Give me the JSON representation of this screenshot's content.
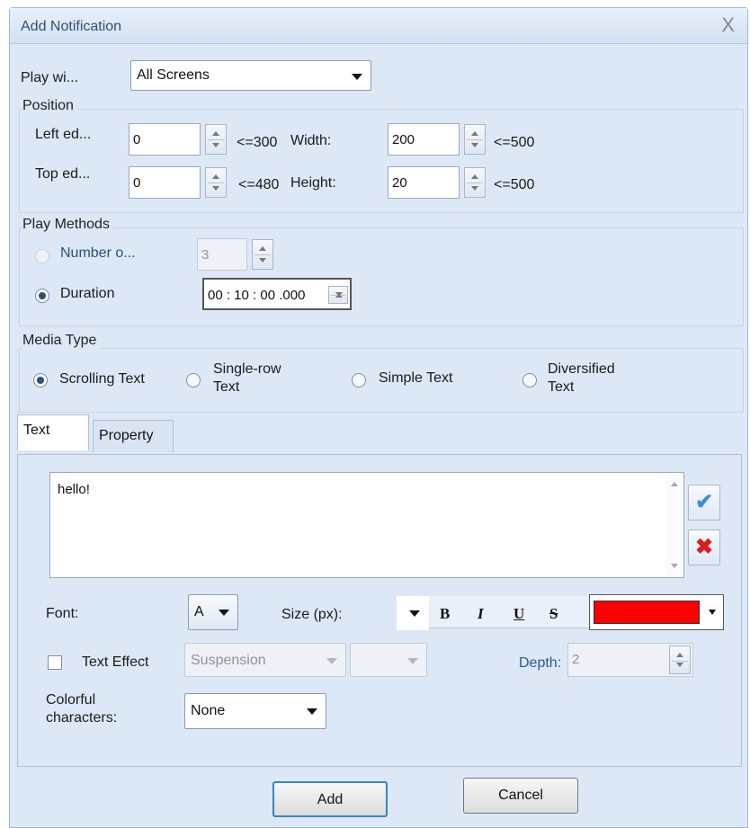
{
  "window": {
    "title": "Add Notification",
    "close_glyph": "X"
  },
  "play_with": {
    "label": "Play wi...",
    "value": "All Screens"
  },
  "position": {
    "group_label": "Position",
    "left_edge": {
      "label": "Left ed...",
      "value": "0",
      "limit": "<=300"
    },
    "top_edge": {
      "label": "Top ed...",
      "value": "0",
      "limit": "<=480"
    },
    "width": {
      "label": "Width:",
      "value": "200",
      "limit": "<=500"
    },
    "height": {
      "label": "Height:",
      "value": "20",
      "limit": "<=500"
    }
  },
  "play_methods": {
    "group_label": "Play Methods",
    "number_of": {
      "label": "Number o...",
      "value": "3",
      "selected": false,
      "enabled": false
    },
    "duration": {
      "label": "Duration",
      "value": "00 : 10 : 00 .000",
      "selected": true
    }
  },
  "media_type": {
    "group_label": "Media Type",
    "options": [
      {
        "label": "Scrolling Text",
        "selected": true
      },
      {
        "label": "Single-row Text",
        "selected": false
      },
      {
        "label": "Simple Text",
        "selected": false
      },
      {
        "label": "Diversified Text",
        "selected": false
      }
    ]
  },
  "tabs": [
    {
      "label": "Text",
      "active": true
    },
    {
      "label": "Property",
      "active": false
    }
  ],
  "text_panel": {
    "content": "hello!",
    "confirm_icon": "checkmark-icon",
    "delete_icon": "red-x-icon",
    "font_label": "Font:",
    "font_value": "A",
    "size_label": "Size (px):",
    "bold": "B",
    "italic": "I",
    "underline": "U",
    "strike": "S",
    "text_color": "#ff0000",
    "text_effect_label": "Text Effect",
    "text_effect_checked": false,
    "effect_value": "Suspension",
    "depth_label": "Depth:",
    "depth_value": "2",
    "colorful_label": "Colorful characters:",
    "colorful_value": "None"
  },
  "buttons": {
    "add": "Add",
    "cancel": "Cancel"
  }
}
